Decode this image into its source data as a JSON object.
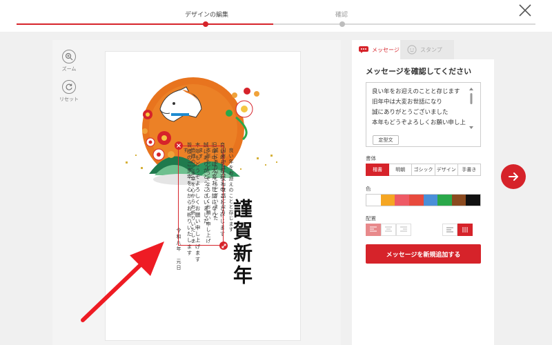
{
  "progress": {
    "steps": [
      {
        "label": "デザインの編集"
      },
      {
        "label": "確認"
      }
    ]
  },
  "colors": {
    "accent": "#d6232a",
    "swatches": [
      "#ffffff",
      "#f5a623",
      "#ee5a65",
      "#e84a3d",
      "#4a8fd8",
      "#2aa84a",
      "#8b4a1f",
      "#111111"
    ]
  },
  "tools": {
    "zoom_label": "ズーム",
    "reset_label": "リセット"
  },
  "card": {
    "greeting_big": "謹賀新年",
    "body_lines": [
      "良い年をお迎えのことと存じます",
      "旧年中は大変お世話になり",
      "誠にありがとうございました",
      "本年もどうぞよろしくお願い申し上げます",
      "皆様のご多幸を心からお祈りいたします"
    ],
    "date_line": "令和八年　元日",
    "selected_lines": [
      "良い年をお迎えのことと存じます",
      "旧年中は大変お世話になり",
      "誠にありがとうございました",
      "本年もどうぞよろしくお願い申し上げます",
      "皆様のご多幸を心からお祈りいたします"
    ],
    "selected_date": "令和八年　元日"
  },
  "panel": {
    "tabs": [
      {
        "label": "メッセージ",
        "active": true
      },
      {
        "label": "スタンプ",
        "active": false
      }
    ],
    "title": "メッセージを確認してください",
    "message_lines": [
      "良い年をお迎えのことと存じます",
      "旧年中は大変お世話になり",
      "誠にありがとうございました",
      "本年もどうぞよろしくお願い申し上"
    ],
    "template_button": "定型文",
    "font_label": "書体",
    "font_options": [
      "楷書",
      "明朝",
      "ゴシック",
      "デザイン",
      "手書き"
    ],
    "font_selected": "楷書",
    "color_label": "色",
    "align_label": "配置",
    "add_button": "メッセージを新規追加する"
  }
}
